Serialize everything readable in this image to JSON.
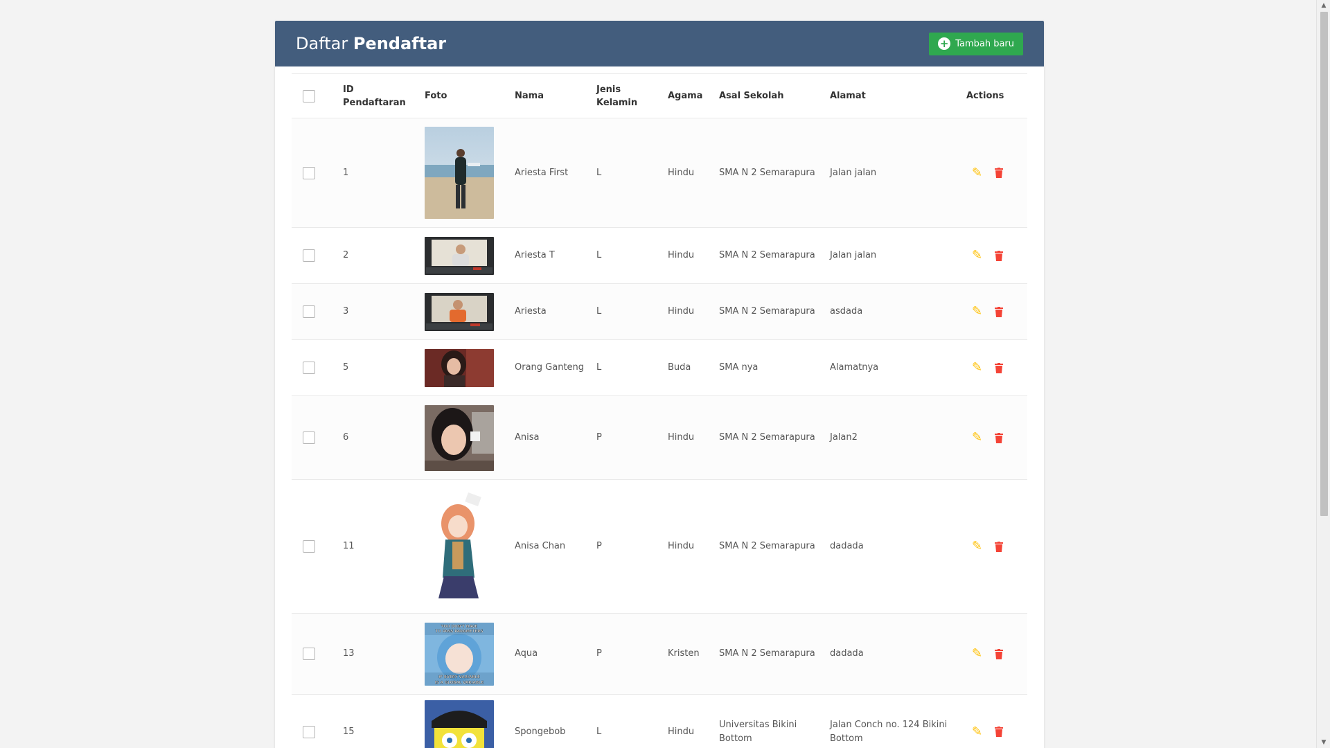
{
  "header": {
    "title_prefix": "Daftar",
    "title_bold": "Pendaftar",
    "add_button_label": "Tambah baru"
  },
  "table": {
    "columns": {
      "id": "ID Pendaftaran",
      "foto": "Foto",
      "nama": "Nama",
      "jk": "Jenis Kelamin",
      "agama": "Agama",
      "sekolah": "Asal Sekolah",
      "alamat": "Alamat",
      "actions": "Actions"
    },
    "rows": [
      {
        "id": "1",
        "nama": "Ariesta First",
        "jk": "L",
        "agama": "Hindu",
        "sekolah": "SMA N 2 Semarapura",
        "alamat": "Jalan jalan"
      },
      {
        "id": "2",
        "nama": "Ariesta T",
        "jk": "L",
        "agama": "Hindu",
        "sekolah": "SMA N 2 Semarapura",
        "alamat": "Jalan jalan"
      },
      {
        "id": "3",
        "nama": "Ariesta",
        "jk": "L",
        "agama": "Hindu",
        "sekolah": "SMA N 2 Semarapura",
        "alamat": "asdada"
      },
      {
        "id": "5",
        "nama": "Orang Ganteng",
        "jk": "L",
        "agama": "Buda",
        "sekolah": "SMA nya",
        "alamat": "Alamatnya"
      },
      {
        "id": "6",
        "nama": "Anisa",
        "jk": "P",
        "agama": "Hindu",
        "sekolah": "SMA N 2 Semarapura",
        "alamat": "Jalan2"
      },
      {
        "id": "11",
        "nama": "Anisa Chan",
        "jk": "P",
        "agama": "Hindu",
        "sekolah": "SMA N 2 Semarapura",
        "alamat": "dadada"
      },
      {
        "id": "13",
        "nama": "Aqua",
        "jk": "P",
        "agama": "Kristen",
        "sekolah": "SMA N 2 Semarapura",
        "alamat": "dadada",
        "photo_caption": "YOU DON'T HAVE TO PASS PARAMETERS IF EVERY VARIABLE IS A GLOBAL VARIABLE"
      },
      {
        "id": "15",
        "nama": "Spongebob",
        "jk": "L",
        "agama": "Hindu",
        "sekolah": "Universitas Bikini Bottom",
        "alamat": "Jalan Conch no. 124 Bikini Bottom"
      }
    ]
  },
  "colors": {
    "header_bg": "#435d7d",
    "add_button": "#2fa84f",
    "edit_icon": "#ffc107",
    "delete_icon": "#f44336"
  },
  "icons": {
    "add": "plus-circle-icon",
    "edit": "pencil-icon",
    "delete": "trash-icon"
  }
}
